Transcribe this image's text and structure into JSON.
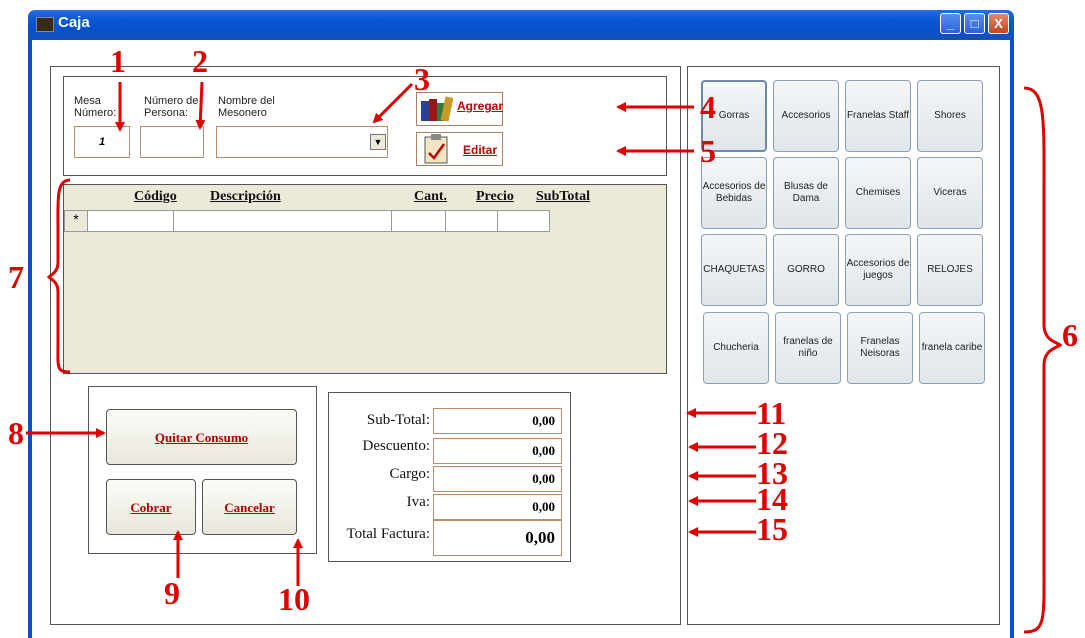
{
  "window": {
    "title": "Caja",
    "btn_min": "_",
    "btn_max": "□",
    "btn_close": "X"
  },
  "header": {
    "mesa_label": "Mesa Número:",
    "mesa_value": "1",
    "personas_label": "Número de Persona:",
    "personas_value": "",
    "mesonero_label": "Nombre del Mesonero",
    "mesonero_value": "",
    "agregar_label": "Agregar",
    "editar_label": "Editar"
  },
  "grid": {
    "columns": [
      "Código",
      "Descripción",
      "Cant.",
      "Precio",
      "SubTotal"
    ],
    "new_row_marker": "*"
  },
  "actions": {
    "quitar_label": "Quitar Consumo",
    "cobrar_label": "Cobrar",
    "cancelar_label": "Cancelar"
  },
  "totals": [
    {
      "label": "Sub-Total:",
      "value": "0,00"
    },
    {
      "label": "Descuento:",
      "value": "0,00"
    },
    {
      "label": "Cargo:",
      "value": "0,00"
    },
    {
      "label": "Iva:",
      "value": "0,00"
    },
    {
      "label": "Total Factura:",
      "value": "0,00"
    }
  ],
  "products": [
    [
      "Gorras",
      "Accesorios",
      "Franelas Staff",
      "Shores"
    ],
    [
      "Accesorios de Bebidas",
      "Blusas de Dama",
      "Chemises",
      "Viceras"
    ],
    [
      "CHAQUETAS",
      "GORRO",
      "Accesorios de juegos",
      "RELOJES"
    ],
    [
      "Chucheria",
      "franelas de niño",
      "Franelas Neisoras",
      "franela caribe"
    ]
  ],
  "annotations": [
    "1",
    "2",
    "3",
    "4",
    "5",
    "6",
    "7",
    "8",
    "9",
    "10",
    "11",
    "12",
    "13",
    "14",
    "15"
  ],
  "colors": {
    "annotation": "#e00000",
    "titlebar": "#0a58d6",
    "action_text": "#b00000"
  }
}
